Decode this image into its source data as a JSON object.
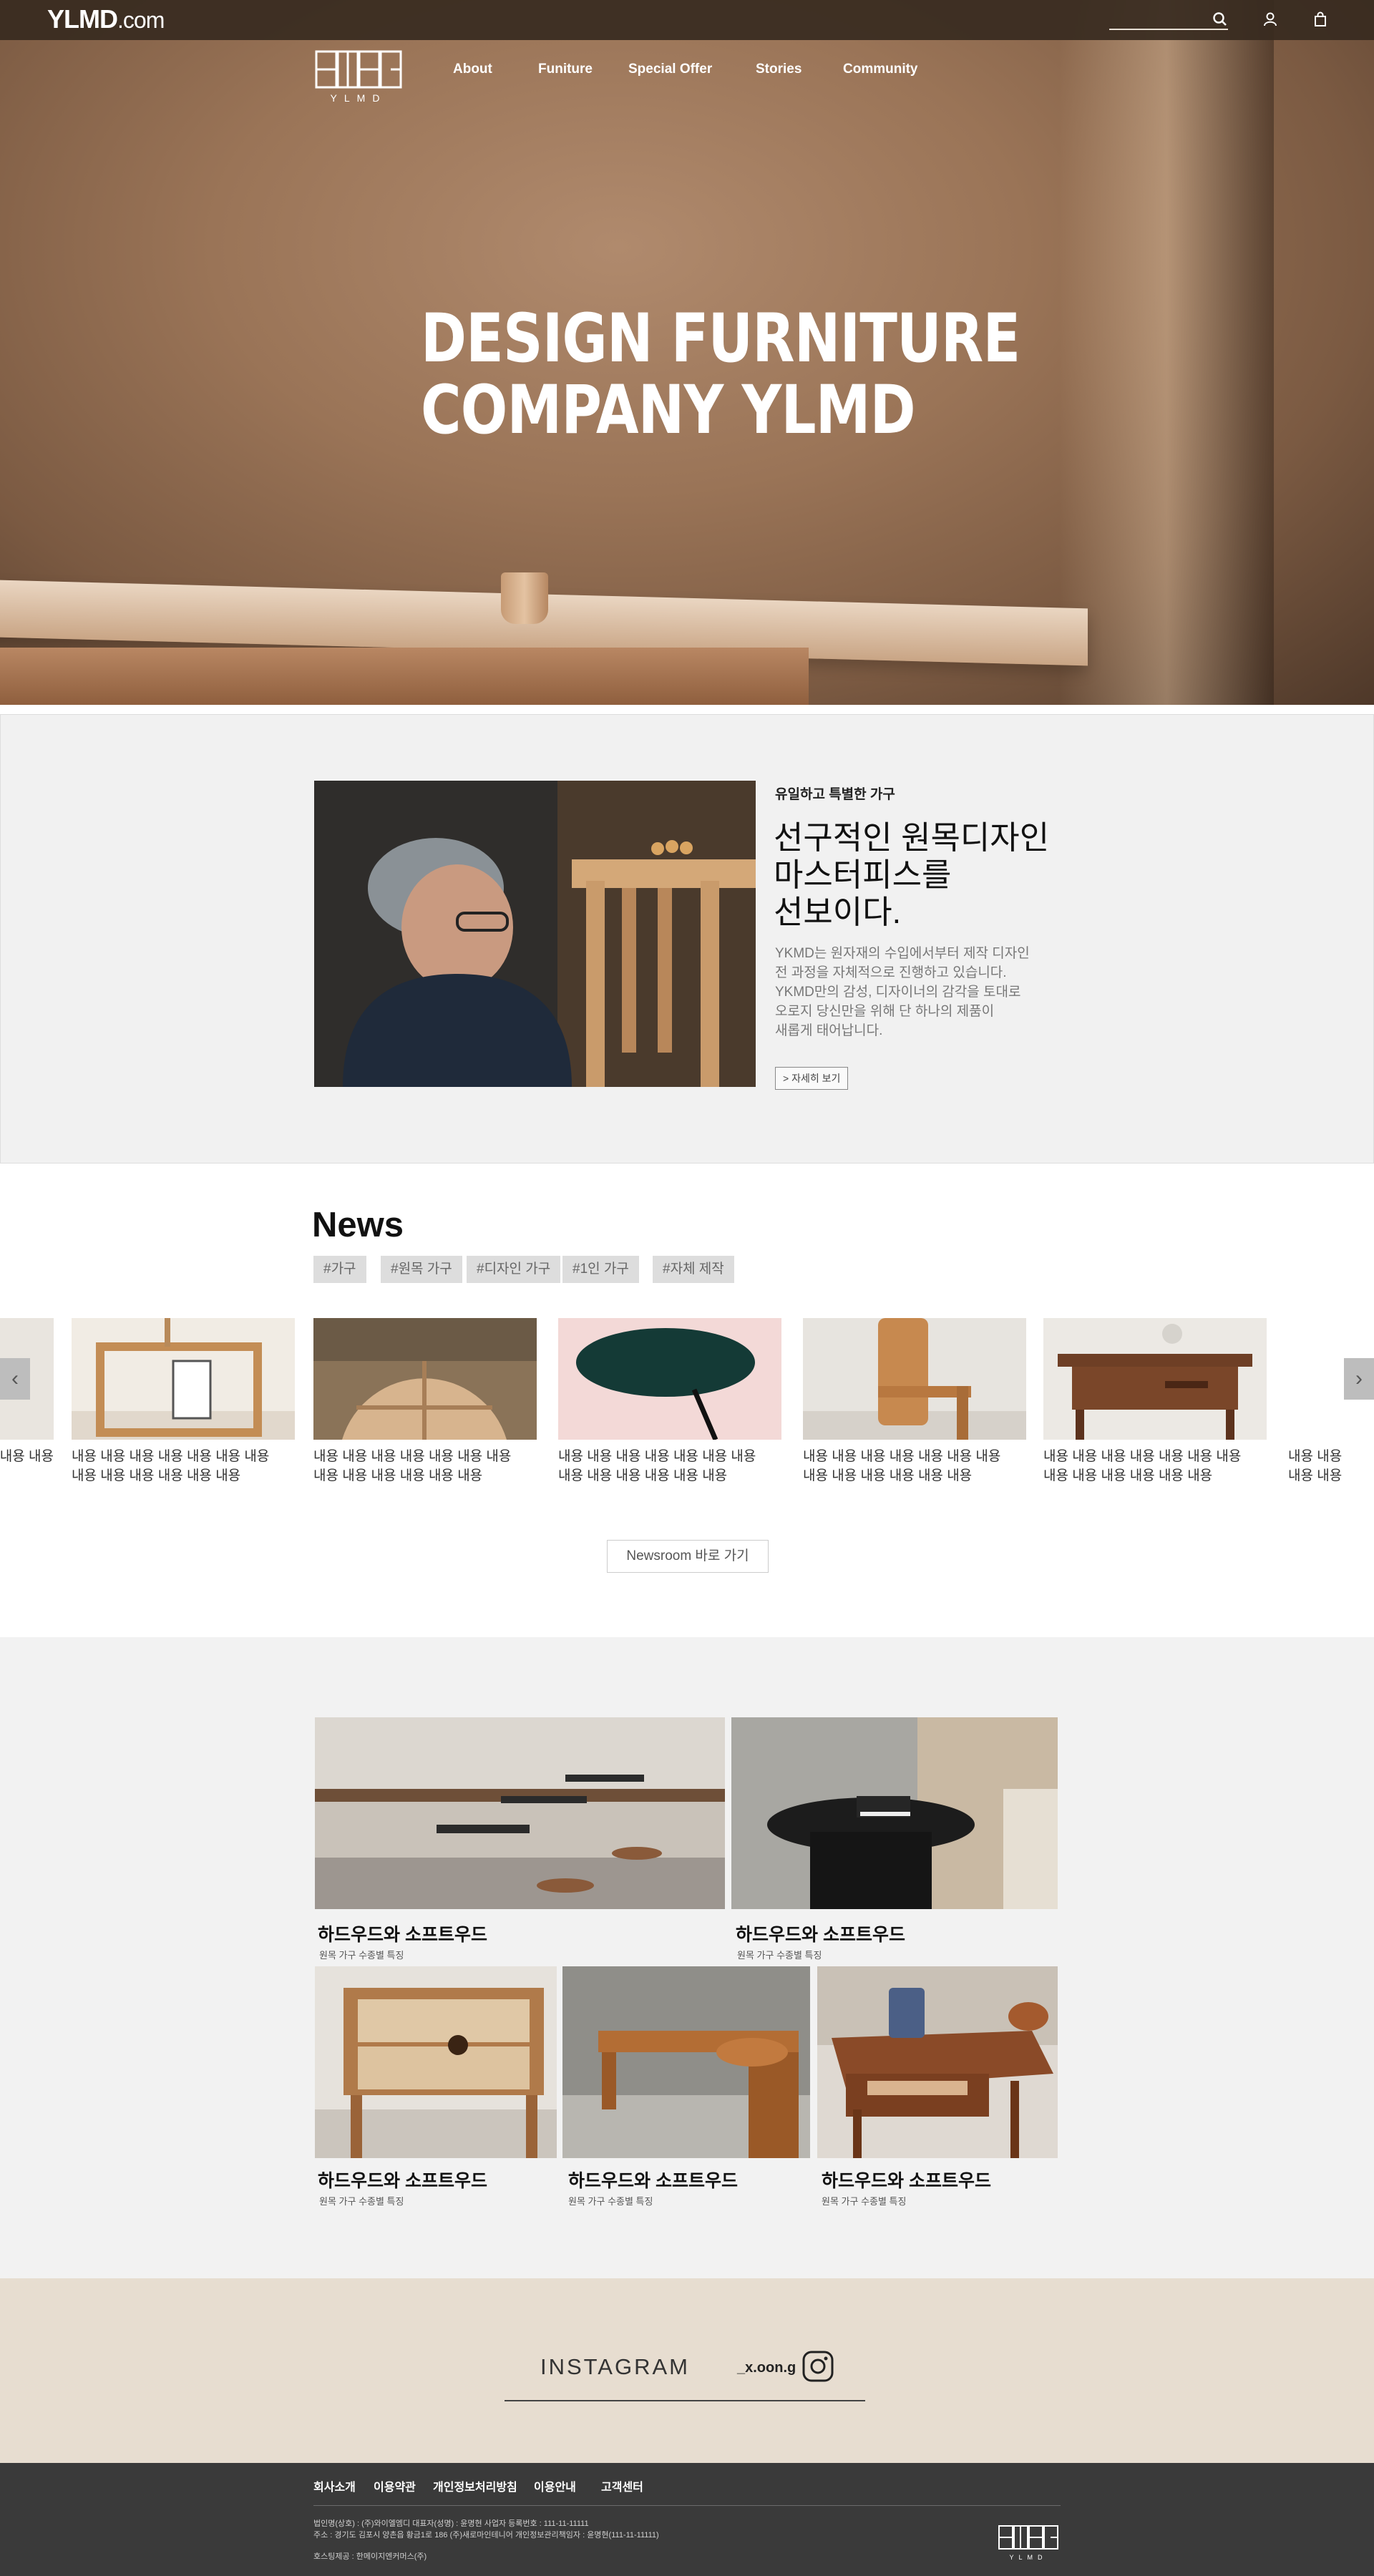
{
  "brand": {
    "name": "YLMD",
    "suffix": ".com"
  },
  "header": {
    "search_placeholder": "",
    "icons": [
      "search-icon",
      "user-icon",
      "bag-icon"
    ]
  },
  "nav": {
    "logo_text": "YLMD",
    "items": [
      {
        "label": "About"
      },
      {
        "label": "Funiture"
      },
      {
        "label": "Special Offer"
      },
      {
        "label": "Stories"
      },
      {
        "label": "Community"
      }
    ]
  },
  "hero": {
    "line1": "DESIGN FURNITURE",
    "line2": "COMPANY YLMD"
  },
  "intro": {
    "kicker": "유일하고 특별한 가구",
    "heading_lines": [
      "선구적인 원목디자인",
      "마스터피스를",
      "선보이다."
    ],
    "body_lines": [
      "YKMD는 원자재의 수입에서부터 제작 디자인",
      "전 과정을 자체적으로 진행하고 있습니다.",
      "YKMD만의 감성, 디자이너의 감각을 토대로",
      "오로지 당신만을 위해 단 하나의 제품이",
      "새롭게 태어납니다."
    ],
    "button_label": "> 자세히 보기"
  },
  "news": {
    "title": "News",
    "tags": [
      "#가구",
      "#원목 가구",
      "#디자인 가구",
      "#1인 가구",
      "#자체 제작"
    ],
    "cards": [
      {
        "line1": "내용 내용 내용 내용 내용 내용 내용",
        "line2": "내용 내용 내용 내용 내용 내용"
      },
      {
        "line1": "내용 내용 내용 내용 내용 내용 내용",
        "line2": "내용 내용 내용 내용 내용 내용"
      },
      {
        "line1": "내용 내용 내용 내용 내용 내용 내용",
        "line2": "내용 내용 내용 내용 내용 내용"
      },
      {
        "line1": "내용 내용 내용 내용 내용 내용 내용",
        "line2": "내용 내용 내용 내용 내용 내용"
      },
      {
        "line1": "내용 내용 내용 내용 내용 내용 내용",
        "line2": "내용 내용 내용 내용 내용 내용"
      }
    ],
    "left_partial": "내용 내용",
    "right_partial_line1": "내용 내용",
    "right_partial_line2": "내용 내용",
    "prev_arrow": "‹",
    "next_arrow": "›",
    "newsroom_button": "Newsroom 바로 가기"
  },
  "collection": {
    "tiles": [
      {
        "title": "하드우드와 소프트우드",
        "subtitle": "원목 가구 수종별 특징"
      },
      {
        "title": "하드우드와 소프트우드",
        "subtitle": "원목 가구 수종별 특징"
      },
      {
        "title": "하드우드와 소프트우드",
        "subtitle": "원목 가구 수종별 특징"
      },
      {
        "title": "하드우드와 소프트우드",
        "subtitle": "원목 가구 수종별 특징"
      },
      {
        "title": "하드우드와 소프트우드",
        "subtitle": "원목 가구 수종별 특징"
      }
    ]
  },
  "instagram": {
    "label": "INSTAGRAM",
    "handle": "_x.oon.g"
  },
  "footer": {
    "links": [
      "회사소개",
      "이용약관",
      "개인정보처리방침",
      "이용안내",
      "고객센터"
    ],
    "info_line1": "법인명(상호) : (주)와이엘엠디 대표자(성명) : 윤명현 사업자 등록번호 : 111-11-11111",
    "info_line2": "주소 : 경기도 김포시 양촌읍 황금1로 186 (주)새로마인테니어 개인정보관리책임자 : 윤명현(111-11-11111)",
    "info_line3": "호스팅제공 : 한메이지엔커머스(주)",
    "logo_text": "YLMD"
  },
  "colors": {
    "topbar": "#372a20",
    "intro_bg": "#f1f1f1",
    "collection_bg": "#f2f2f2",
    "instagram_bg": "#e7ddd0",
    "footer_bg": "#3a3a3a",
    "tag_bg": "#dddddd"
  }
}
